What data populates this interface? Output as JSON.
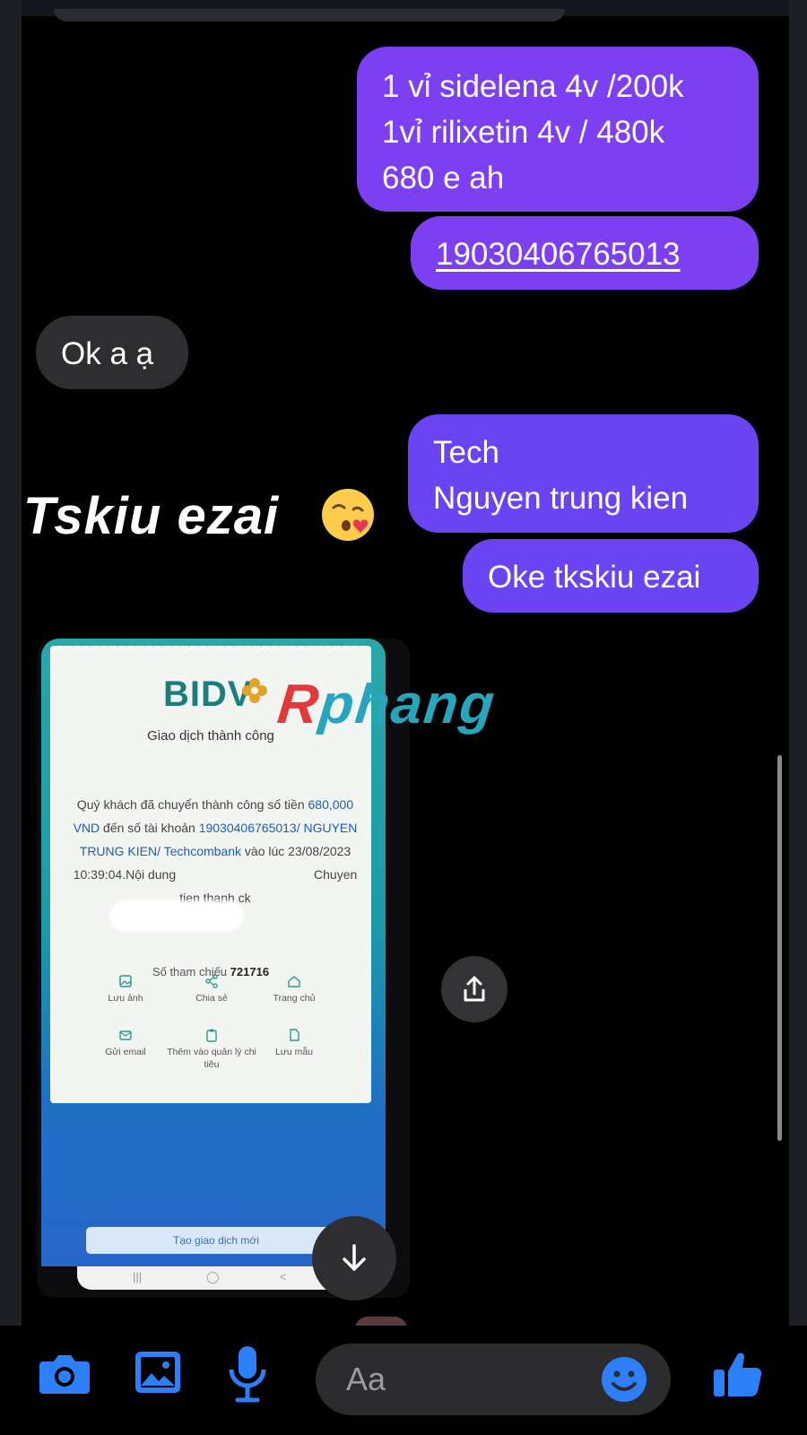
{
  "messages": [
    {
      "direction": "outgoing",
      "lines": [
        "1 vỉ sidelena 4v /200k",
        "1vỉ rilixetin 4v / 480k",
        "680 e ah"
      ]
    },
    {
      "direction": "outgoing",
      "lines": [
        "19030406765013"
      ],
      "style": "link"
    },
    {
      "direction": "incoming",
      "lines": [
        "Ok a ạ"
      ]
    },
    {
      "direction": "outgoing",
      "lines": [
        "Tech",
        "Nguyen trung kien"
      ]
    },
    {
      "direction": "outgoing",
      "lines": [
        "Oke tkskiu ezai"
      ]
    }
  ],
  "overlay": {
    "text": "Tskiu ezai",
    "emoji": "kissing-heart-emoji"
  },
  "receipt": {
    "bank_logo": "BIDV",
    "watermark": "Rphang",
    "title": "Giao dịch thành công",
    "message_parts": {
      "p1": "Quý khách đã chuyển thành công số tiền ",
      "amount": "680,000 VND",
      "p2": " đến số tài khoản ",
      "account": "19030406765013/ NGUYEN TRUNG KIEN/ Techcombank",
      "p3": " vào lúc 23/08/2023 10:39:04.Nội dung",
      "p4": " Chuyen tien thanh ck"
    },
    "ref_label": "Số tham chiếu",
    "ref_number": "721716",
    "actions": [
      {
        "label": "Lưu ảnh",
        "icon": "image-icon"
      },
      {
        "label": "Chia sẻ",
        "icon": "share-icon"
      },
      {
        "label": "Trang chủ",
        "icon": "home-icon"
      },
      {
        "label": "Gửi email",
        "icon": "mail-icon"
      },
      {
        "label": "Thêm vào quản lý chi tiêu",
        "icon": "clipboard-icon"
      },
      {
        "label": "Lưu mẫu",
        "icon": "document-icon"
      }
    ],
    "new_transaction_label": "Tạo giao dịch mới",
    "navbar": [
      "|||",
      "◯",
      "<"
    ]
  },
  "composer": {
    "placeholder": "Aa"
  },
  "colors": {
    "outgoing_bubble": "#7d3ff2",
    "incoming_bubble": "#2e2e30",
    "accent_blue": "#2d7ff9",
    "background": "#000000"
  },
  "icons": [
    "camera-icon",
    "gallery-icon",
    "microphone-icon",
    "emoji-icon",
    "thumbs-up-icon",
    "share-icon",
    "arrow-down-icon"
  ]
}
